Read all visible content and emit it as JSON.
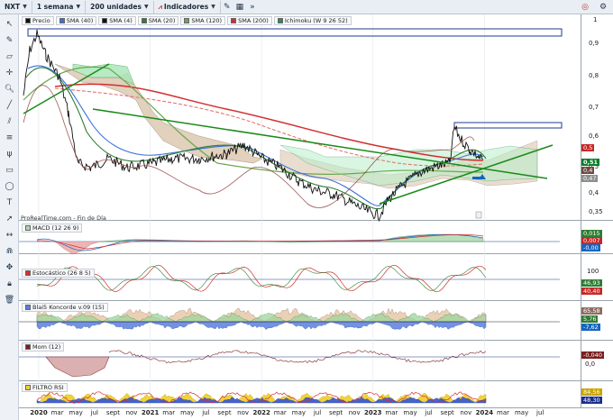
{
  "toolbar": {
    "symbol": "NXT",
    "period": "1 semana",
    "units": "200 unidades",
    "indicators": "Indicadores"
  },
  "main_legend": {
    "price": "Precio",
    "items": [
      {
        "label": "SMA (40)",
        "color": "#3b6fd8"
      },
      {
        "label": "SMA (4)",
        "color": "#111111"
      },
      {
        "label": "SMA (20)",
        "color": "#2e7d32"
      },
      {
        "label": "SMA (120)",
        "color": "#6aa84f"
      },
      {
        "label": "SMA (200)",
        "color": "#d32f2f"
      },
      {
        "label": "Ichimoku (W 9 26 52)",
        "color": "#2e8b57"
      }
    ]
  },
  "price_axis": [
    "1",
    "0,9",
    "0,8",
    "0,7",
    "0,6",
    "0,5",
    "0,4",
    "0,35"
  ],
  "price_tags": [
    {
      "text": "0,5",
      "color": "#c62828"
    },
    {
      "text": "0,51",
      "color": "#0b7d2a"
    },
    {
      "text": "0,4",
      "color": "#6d4c41"
    },
    {
      "text": "0,47",
      "color": "#8e8e8e"
    }
  ],
  "source": "ProRealTime.com - Fin de Día",
  "panels": {
    "macd": {
      "title": "MACD (12 26 9)",
      "values": [
        "0,015",
        "0,007",
        "-0,00"
      ]
    },
    "stoch": {
      "title": "Estocástico (26 8 5)",
      "values": [
        "100",
        "46,93",
        "40,40"
      ]
    },
    "blai5": {
      "title": "Blai5 Koncorde v.09 (15)",
      "values": [
        "65,58",
        "5,76",
        "-7,62"
      ]
    },
    "mom": {
      "title": "Mom (12)",
      "values": [
        "-0,040",
        "0,0"
      ]
    },
    "rsi": {
      "title": "FILTRO RSI",
      "values": [
        "84,56",
        "48,30"
      ]
    }
  },
  "x_axis": [
    {
      "label": "2020",
      "year": true
    },
    {
      "label": "mar",
      "year": false
    },
    {
      "label": "may",
      "year": false
    },
    {
      "label": "jul",
      "year": false
    },
    {
      "label": "sept",
      "year": false
    },
    {
      "label": "nov",
      "year": false
    },
    {
      "label": "2021",
      "year": true
    },
    {
      "label": "mar",
      "year": false
    },
    {
      "label": "may",
      "year": false
    },
    {
      "label": "jul",
      "year": false
    },
    {
      "label": "sept",
      "year": false
    },
    {
      "label": "nov",
      "year": false
    },
    {
      "label": "2022",
      "year": true
    },
    {
      "label": "mar",
      "year": false
    },
    {
      "label": "may",
      "year": false
    },
    {
      "label": "jul",
      "year": false
    },
    {
      "label": "sept",
      "year": false
    },
    {
      "label": "nov",
      "year": false
    },
    {
      "label": "2023",
      "year": true
    },
    {
      "label": "mar",
      "year": false
    },
    {
      "label": "may",
      "year": false
    },
    {
      "label": "jul",
      "year": false
    },
    {
      "label": "sept",
      "year": false
    },
    {
      "label": "nov",
      "year": false
    },
    {
      "label": "2024",
      "year": true
    },
    {
      "label": "mar",
      "year": false
    },
    {
      "label": "may",
      "year": false
    },
    {
      "label": "jul",
      "year": false
    }
  ],
  "colors": {
    "accent": "#1f3b8f",
    "sma200": "#d32f2f",
    "cloud_bull": "#a8e6b8",
    "cloud_bear": "#d7c2a8",
    "trendline": "#1a8a1a"
  },
  "icons": [
    "cursor-icon",
    "pencil-icon",
    "ruler-icon",
    "zoom-icon",
    "line-icon",
    "trash-icon"
  ]
}
